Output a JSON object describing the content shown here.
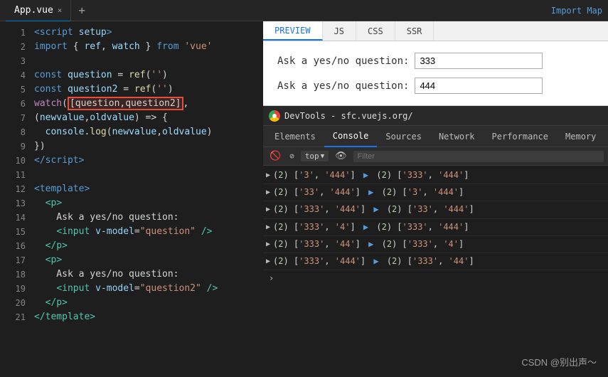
{
  "topbar": {
    "tab_filename": "App.vue",
    "tab_close": "×",
    "tab_add": "+",
    "import_map": "Import Map"
  },
  "preview_tabs": [
    {
      "label": "PREVIEW",
      "active": true
    },
    {
      "label": "JS"
    },
    {
      "label": "CSS"
    },
    {
      "label": "SSR"
    }
  ],
  "preview": {
    "input1_label": "Ask a yes/no question:",
    "input1_value": "333",
    "input2_label": "Ask a yes/no question:",
    "input2_value": "444"
  },
  "devtools": {
    "title": "DevTools - sfc.vuejs.org/",
    "tabs": [
      "Elements",
      "Console",
      "Sources",
      "Network",
      "Performance",
      "Memory"
    ],
    "active_tab": "Console",
    "toolbar": {
      "level": "top",
      "filter_placeholder": "Filter"
    },
    "console_lines": [
      {
        "arrow": "▶",
        "content": "(2) ['3', '444'] ▶ (2) ['333', '444']"
      },
      {
        "arrow": "▶",
        "content": "(2) ['33', '444'] ▶ (2) ['3', '444']"
      },
      {
        "arrow": "▶",
        "content": "(2) ['333', '444'] ▶ (2) ['33', '444']"
      },
      {
        "arrow": "▶",
        "content": "(2) ['333', '4'] ▶ (2) ['333', '444']"
      },
      {
        "arrow": "▶",
        "content": "(2) ['333', '44'] ▶ (2) ['333', '4']"
      },
      {
        "arrow": "▶",
        "content": "(2) ['333', '444'] ▶ (2) ['333', '44']"
      }
    ]
  },
  "code_lines": [
    {
      "num": 1,
      "html": "<span class='kw'>\\u003cscript</span> <span class='attr'>setup</span><span class='kw'>\\u003e</span>"
    },
    {
      "num": 2,
      "html": "<span class='kw'>import</span> { <span class='var'>ref</span>, <span class='var'>watch</span> } <span class='kw'>from</span> <span class='str'>'vue'</span>"
    },
    {
      "num": 3,
      "html": ""
    },
    {
      "num": 4,
      "html": "<span class='kw'>const</span> <span class='var'>question</span> = <span class='fn'>ref</span>(<span class='str'>''</span>)"
    },
    {
      "num": 5,
      "html": "<span class='kw'>const</span> <span class='var'>question2</span> = <span class='fn'>ref</span>(<span class='str'>''</span>)"
    },
    {
      "num": 6,
      "html": "<span class='kw2'>watch</span>(<span class='highlight'>[question,question2]</span>,"
    },
    {
      "num": 7,
      "html": "(<span class='var'>newvalue</span>,<span class='var'>oldvalue</span>) => {"
    },
    {
      "num": 8,
      "html": "  <span class='var'>console</span>.<span class='fn'>log</span>(<span class='var'>newvalue</span>,<span class='var'>oldvalue</span>)"
    },
    {
      "num": 9,
      "html": "})"
    },
    {
      "num": 10,
      "html": "<span class='kw'>\\u003c/script\\u003e</span>"
    },
    {
      "num": 11,
      "html": ""
    },
    {
      "num": 12,
      "html": "<span class='kw'>\\u003ctemplate\\u003e</span>"
    },
    {
      "num": 13,
      "html": "  <span class='tag'>\\u003cp\\u003e</span>"
    },
    {
      "num": 14,
      "html": "    Ask a yes/no question:"
    },
    {
      "num": 15,
      "html": "    <span class='tag'>\\u003cinput</span> <span class='attr'>v-model</span>=<span class='val'>\"question\"</span> <span class='tag'>/\\u003e</span>"
    },
    {
      "num": 16,
      "html": "  <span class='tag'>\\u003c/p\\u003e</span>"
    },
    {
      "num": 17,
      "html": "  <span class='tag'>\\u003cp\\u003e</span>"
    },
    {
      "num": 18,
      "html": "    Ask a yes/no question:"
    },
    {
      "num": 19,
      "html": "    <span class='tag'>\\u003cinput</span> <span class='attr'>v-model</span>=<span class='val'>\"question2\"</span> <span class='tag'>/\\u003e</span>"
    },
    {
      "num": 20,
      "html": "  <span class='tag'>\\u003c/p\\u003e</span>"
    },
    {
      "num": 21,
      "html": "<span class='kw'>\\u003c/template\\u003e</span>"
    }
  ],
  "watermark": "CSDN @别出声～"
}
